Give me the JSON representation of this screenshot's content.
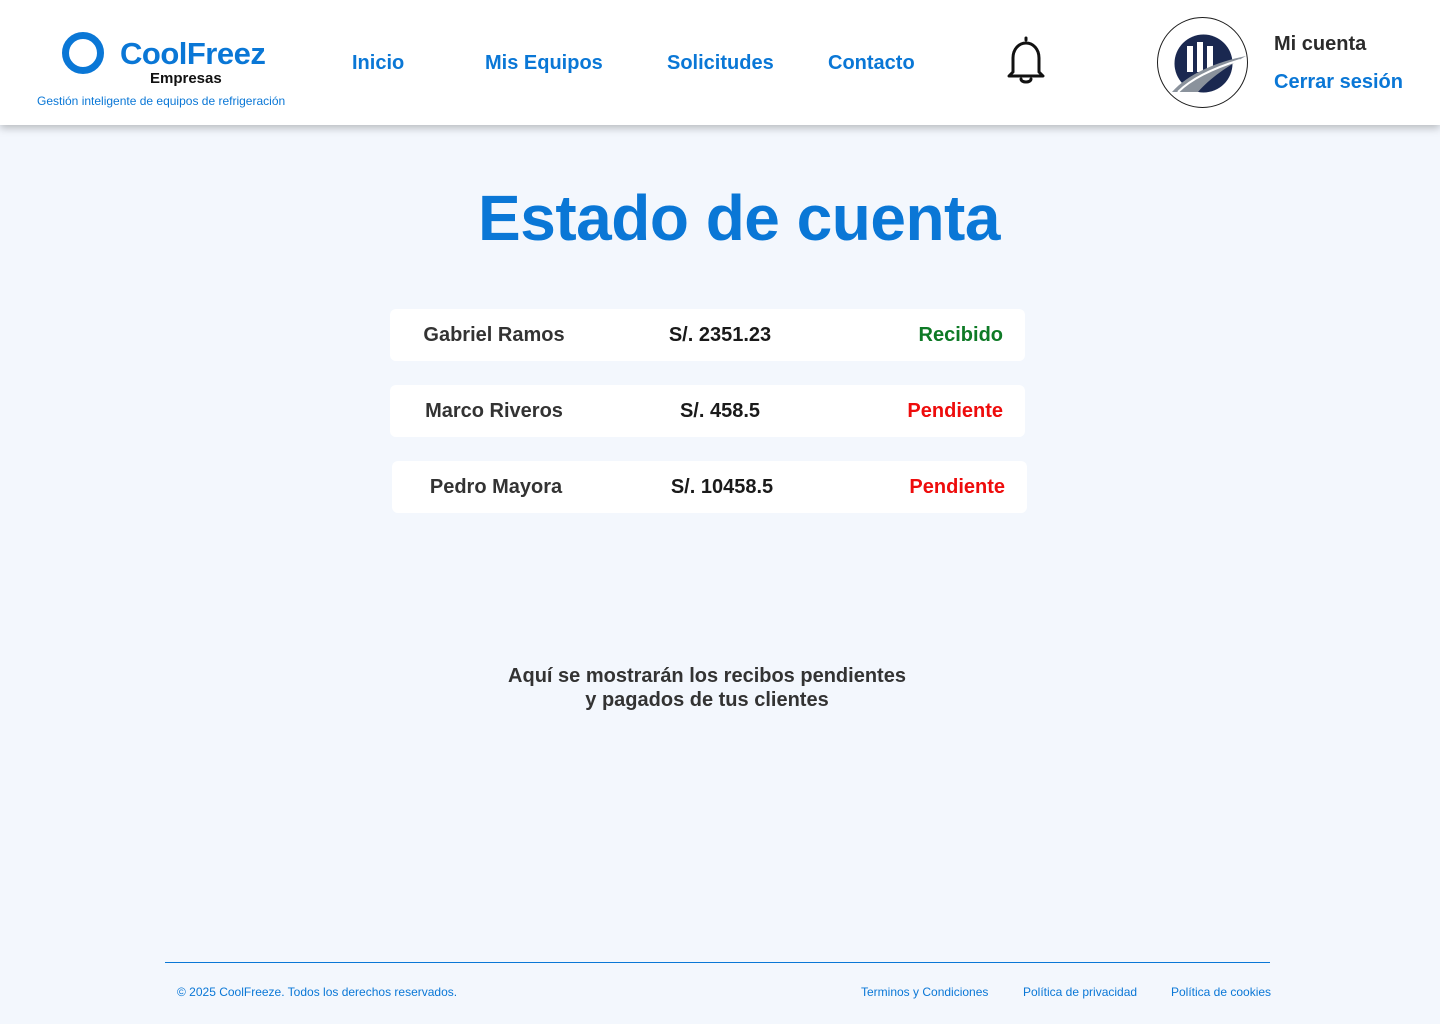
{
  "brand": {
    "name": "CoolFreez",
    "subtitle": "Empresas",
    "tagline": "Gestión inteligente de equipos de refrigeración",
    "color": "#0a77d6"
  },
  "nav": {
    "items": [
      {
        "label": "Inicio"
      },
      {
        "label": "Mis Equipos"
      },
      {
        "label": "Solicitudes"
      },
      {
        "label": "Contacto"
      }
    ],
    "notification_icon": "bell-icon"
  },
  "account": {
    "my_account_label": "Mi cuenta",
    "logout_label": "Cerrar sesión",
    "avatar_icon": "company-logo-avatar"
  },
  "page": {
    "title": "Estado de cuenta"
  },
  "receipts": [
    {
      "client": "Gabriel Ramos",
      "amount": "S/. 2351.23",
      "status": "Recibido",
      "status_color": "#0e7a26"
    },
    {
      "client": "Marco Riveros",
      "amount": "S/. 458.5",
      "status": "Pendiente",
      "status_color": "#ee0c0c"
    },
    {
      "client": "Pedro Mayora",
      "amount": "S/. 10458.5",
      "status": "Pendiente",
      "status_color": "#ee0c0c"
    }
  ],
  "note": {
    "line1": "Aquí se mostrarán los recibos pendientes",
    "line2": "y pagados de tus clientes"
  },
  "footer": {
    "copyright": "© 2025 CoolFreeze. Todos los derechos reservados.",
    "links": [
      {
        "label": "Terminos y Condiciones"
      },
      {
        "label": "Política de privacidad"
      },
      {
        "label": "Política de cookies"
      }
    ]
  }
}
